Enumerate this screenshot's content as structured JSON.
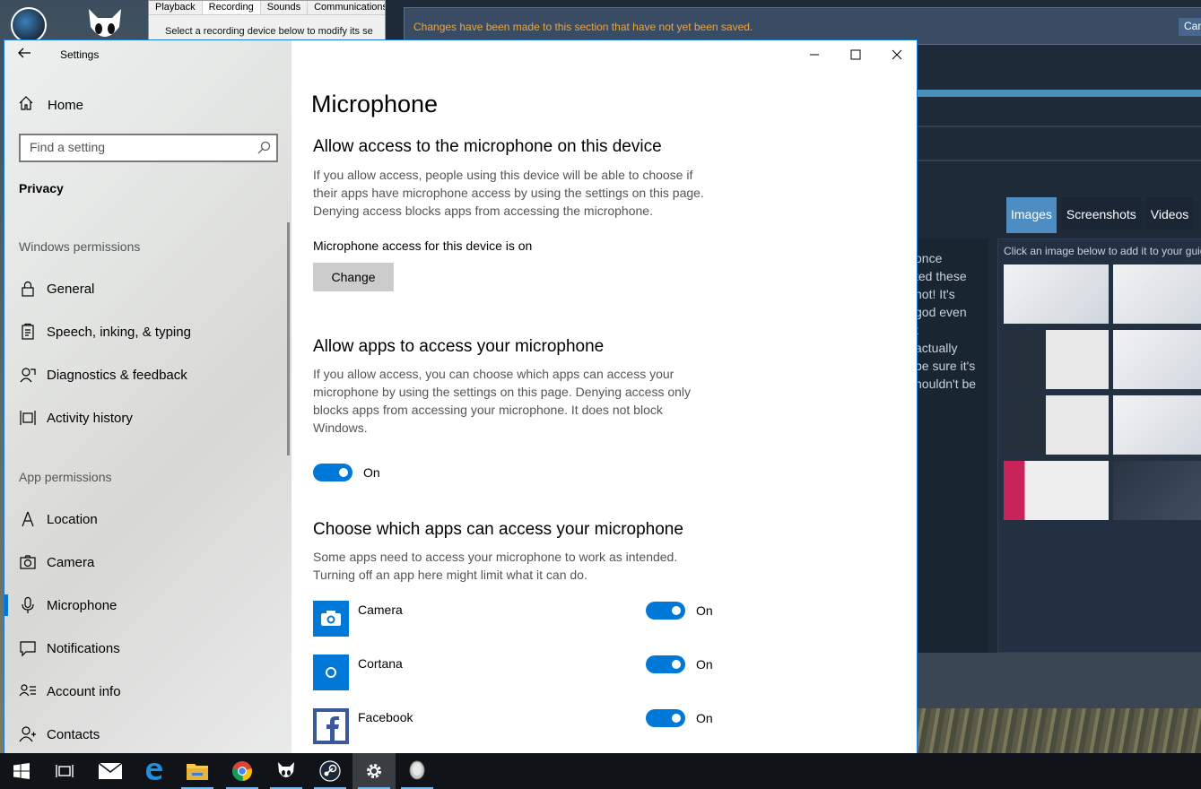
{
  "sound_dialog": {
    "tabs": [
      "Playback",
      "Recording",
      "Sounds",
      "Communications"
    ],
    "active_tab": "Recording",
    "instruction": "Select a recording device below to modify its se"
  },
  "steam": {
    "banner_text": "Changes have been made to this section that have not yet been saved.",
    "cancel_label": "Cancel",
    "tabs": [
      "Images",
      "Screenshots",
      "Videos"
    ],
    "active_tab": "Images",
    "gallery_hint": "Click an image below to add it to your guid",
    "text_fragments": [
      "once",
      "ted these",
      "not! It's",
      "god even",
      "t",
      "actually",
      "be sure it's",
      "houldn't be"
    ]
  },
  "settings": {
    "app_title": "Settings",
    "home_label": "Home",
    "search_placeholder": "Find a setting",
    "section": "Privacy",
    "windows_permissions_label": "Windows permissions",
    "windows_permissions": [
      {
        "label": "General",
        "icon": "lock-icon"
      },
      {
        "label": "Speech, inking, & typing",
        "icon": "clipboard-icon"
      },
      {
        "label": "Diagnostics & feedback",
        "icon": "diagnostics-icon"
      },
      {
        "label": "Activity history",
        "icon": "activity-history-icon"
      }
    ],
    "app_permissions_label": "App permissions",
    "app_permissions": [
      {
        "label": "Location",
        "icon": "location-icon"
      },
      {
        "label": "Camera",
        "icon": "camera-icon"
      },
      {
        "label": "Microphone",
        "icon": "microphone-icon",
        "selected": true
      },
      {
        "label": "Notifications",
        "icon": "notifications-icon"
      },
      {
        "label": "Account info",
        "icon": "account-info-icon"
      },
      {
        "label": "Contacts",
        "icon": "contacts-icon"
      }
    ],
    "page_title": "Microphone",
    "device_section": {
      "heading": "Allow access to the microphone on this device",
      "description": "If you allow access, people using this device will be able to choose if their apps have microphone access by using the settings on this page. Denying access blocks apps from accessing the microphone.",
      "status": "Microphone access for this device is on",
      "change_label": "Change"
    },
    "apps_section": {
      "heading": "Allow apps to access your microphone",
      "description": "If you allow access, you can choose which apps can access your microphone by using the settings on this page. Denying access only blocks apps from accessing your microphone. It does not block Windows.",
      "toggle_label": "On"
    },
    "choose_section": {
      "heading": "Choose which apps can access your microphone",
      "description": "Some apps need to access your microphone to work as intended. Turning off an app here might limit what it can do.",
      "apps": [
        {
          "name": "Camera",
          "state": "On"
        },
        {
          "name": "Cortana",
          "state": "On"
        },
        {
          "name": "Facebook",
          "state": "On"
        }
      ]
    },
    "accent_color": "#0078d7"
  },
  "taskbar": {
    "items": [
      "start-icon",
      "task-view-icon",
      "mail-icon",
      "edge-icon",
      "file-explorer-icon",
      "chrome-icon",
      "alien-app-icon",
      "steam-icon",
      "settings-icon",
      "microphone-app-icon"
    ],
    "active": "settings-icon"
  }
}
